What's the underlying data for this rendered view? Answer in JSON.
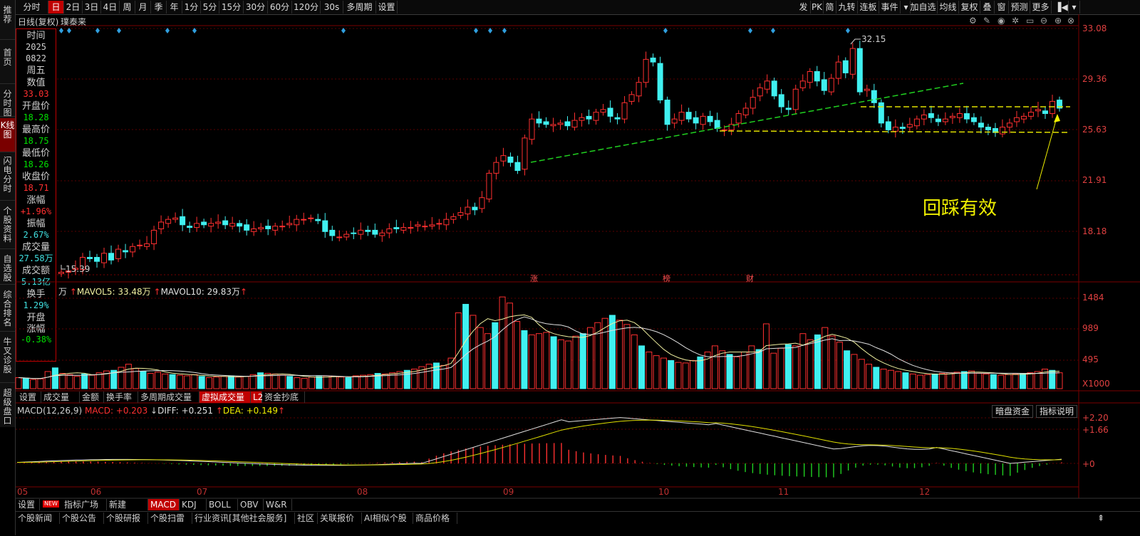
{
  "toolbar": {
    "left_items": [
      "分时",
      "日",
      "2日",
      "3日",
      "4日",
      "周",
      "月",
      "季",
      "年",
      "1分",
      "5分",
      "15分",
      "30分",
      "60分",
      "120分",
      "30s",
      "多周期",
      "设置"
    ],
    "selected": "日",
    "right_items": [
      "发",
      "PK",
      "简",
      "九转",
      "连板",
      "事件",
      "加自选",
      "均线",
      "复权",
      "叠",
      "窗",
      "预测",
      "更多"
    ]
  },
  "left_nav": [
    "推荐",
    "首页",
    "分时图",
    "K线图",
    "闪电分时",
    "个股资料",
    "自选股",
    "综合排名",
    "牛叉诊股",
    "超级盘口"
  ],
  "left_nav_selected": "K线图",
  "chart_header": {
    "period": "日线(复权)",
    "stock": "璞泰来"
  },
  "info_panel": [
    {
      "label": "时间",
      "values": [
        "2025",
        "0822"
      ],
      "color": "#d0d0d0"
    },
    {
      "label": "周五",
      "values": [],
      "color": "#d0d0d0"
    },
    {
      "label": "数值",
      "values": [
        "33.03"
      ],
      "color": "#ff3030"
    },
    {
      "label": "开盘价",
      "values": [
        "18.28"
      ],
      "color": "#00e000"
    },
    {
      "label": "最高价",
      "values": [
        "18.75"
      ],
      "color": "#00e000"
    },
    {
      "label": "最低价",
      "values": [
        "18.26"
      ],
      "color": "#00e000"
    },
    {
      "label": "收盘价",
      "values": [
        "18.71"
      ],
      "color": "#ff3030"
    },
    {
      "label": "涨幅",
      "values": [
        "+1.96%"
      ],
      "color": "#ff3030"
    },
    {
      "label": "振幅",
      "values": [
        "2.67%"
      ],
      "color": "#40e0e0"
    },
    {
      "label": "成交量",
      "values": [
        "27.58万"
      ],
      "color": "#40e0e0"
    },
    {
      "label": "成交额",
      "values": [
        "5.13亿"
      ],
      "color": "#40e0e0"
    },
    {
      "label": "换手",
      "values": [
        "1.29%"
      ],
      "color": "#40e0e0"
    },
    {
      "label": "开盘涨幅",
      "values": [
        "-0.38%"
      ],
      "color": "#00e000"
    }
  ],
  "price_axis": [
    "33.08",
    "29.36",
    "25.63",
    "21.91",
    "18.18"
  ],
  "annotations": {
    "high": "32.15",
    "low": "15.39",
    "text": "回踩有效"
  },
  "event_markers": [
    "涨",
    "榜",
    "财"
  ],
  "volume_header": {
    "unit": "万",
    "mavol5": "MAVOL5: 33.48万",
    "mavol10": "MAVOL10: 29.83万"
  },
  "volume_axis": [
    "1484",
    "989",
    "495",
    "X1000"
  ],
  "volume_tabs": [
    "设置",
    "成交量",
    "金额",
    "换手率",
    "多周期成交量",
    "虚拟成交量",
    "L2",
    "资金抄底"
  ],
  "volume_tab_selected": "虚拟成交量",
  "macd_header": {
    "name": "MACD(12,26,9)",
    "macd": "MACD: +0.203",
    "diff": "DIFF: +0.251",
    "dea": "DEA: +0.149"
  },
  "macd_buttons": [
    "暗盘资金",
    "指标说明"
  ],
  "macd_axis": [
    "+2.20",
    "+1.66",
    "+0"
  ],
  "x_axis_months": [
    "05",
    "06",
    "07",
    "08",
    "09",
    "10",
    "11",
    "12"
  ],
  "indicator_tabs": [
    "设置",
    "指标广场",
    "新建",
    "MACD",
    "KDJ",
    "BOLL",
    "OBV",
    "W&R"
  ],
  "indicator_tab_selected": "MACD",
  "bottom_tabs": [
    "个股新闻",
    "个股公告",
    "个股研报",
    "个股扫雷",
    "行业资讯[其他社会服务]",
    "社区",
    "关联报价",
    "AI相似个股",
    "商品价格"
  ],
  "colors": {
    "up": "#ff3030",
    "down": "#40f0f0",
    "ma5": "#f0f0a0",
    "ma10": "#e0e0e0",
    "trend": "#20d020",
    "support": "#e0e000"
  },
  "chart_data": {
    "type": "candlestick",
    "x_axis_labels": [
      "05",
      "06",
      "07",
      "08",
      "09",
      "10",
      "11",
      "12"
    ],
    "y_axis_ticks": [
      33.08,
      29.36,
      25.63,
      21.91,
      18.18
    ],
    "ylim": [
      15.0,
      34.0
    ],
    "high_label": 32.15,
    "low_label": 15.39,
    "annotation": "回踩有效"
  }
}
